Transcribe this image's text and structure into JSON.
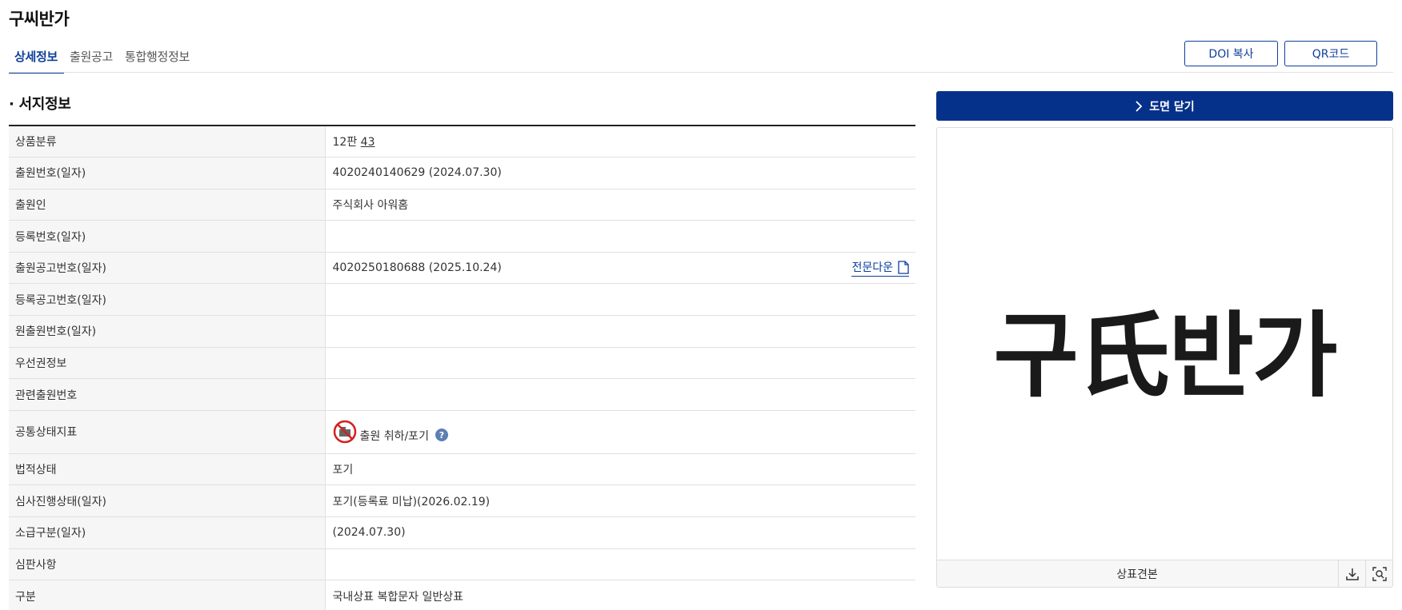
{
  "page": {
    "title": "구씨반가"
  },
  "tabs": [
    {
      "label": "상세정보",
      "active": true
    },
    {
      "label": "출원공고",
      "active": false
    },
    {
      "label": "통합행정정보",
      "active": false
    }
  ],
  "buttons": {
    "doi": "DOI 복사",
    "qr": "QR코드",
    "close_drawing": "도면 닫기"
  },
  "section": {
    "title": "· 서지정보"
  },
  "bib": {
    "rows": [
      {
        "label": "상품분류",
        "value_prefix": "12판 ",
        "value_link": "43"
      },
      {
        "label": "출원번호(일자)",
        "value": "4020240140629 (2024.07.30)"
      },
      {
        "label": "출원인",
        "value": "주식회사 아워홈"
      },
      {
        "label": "등록번호(일자)",
        "value": ""
      },
      {
        "label": "출원공고번호(일자)",
        "value": "4020250180688 (2025.10.24)",
        "link": "전문다운"
      },
      {
        "label": "등록공고번호(일자)",
        "value": ""
      },
      {
        "label": "원출원번호(일자)",
        "value": ""
      },
      {
        "label": "우선권정보",
        "value": ""
      },
      {
        "label": "관련출원번호",
        "value": ""
      },
      {
        "label": "공통상태지표",
        "value": "출원 취하/포기",
        "help": "?"
      },
      {
        "label": "법적상태",
        "value": "포기"
      },
      {
        "label": "심사진행상태(일자)",
        "value": "포기(등록료 미납)(2026.02.19)"
      },
      {
        "label": "소급구분(일자)",
        "value": "(2024.07.30)"
      },
      {
        "label": "심판사항",
        "value": ""
      },
      {
        "label": "구분",
        "value": "국내상표 복합문자 일반상표"
      }
    ]
  },
  "preview": {
    "mark_text": "구氏반가",
    "caption": "상표견본"
  },
  "colors": {
    "accent": "#0d3f9b",
    "close_button_bg": "#06318a",
    "status_red": "#d32020"
  },
  "icons": {
    "chevron": "chevron-right-icon",
    "document": "document-icon",
    "prohibit": "prohibit-status-icon",
    "download": "download-icon",
    "zoom": "zoom-icon"
  }
}
